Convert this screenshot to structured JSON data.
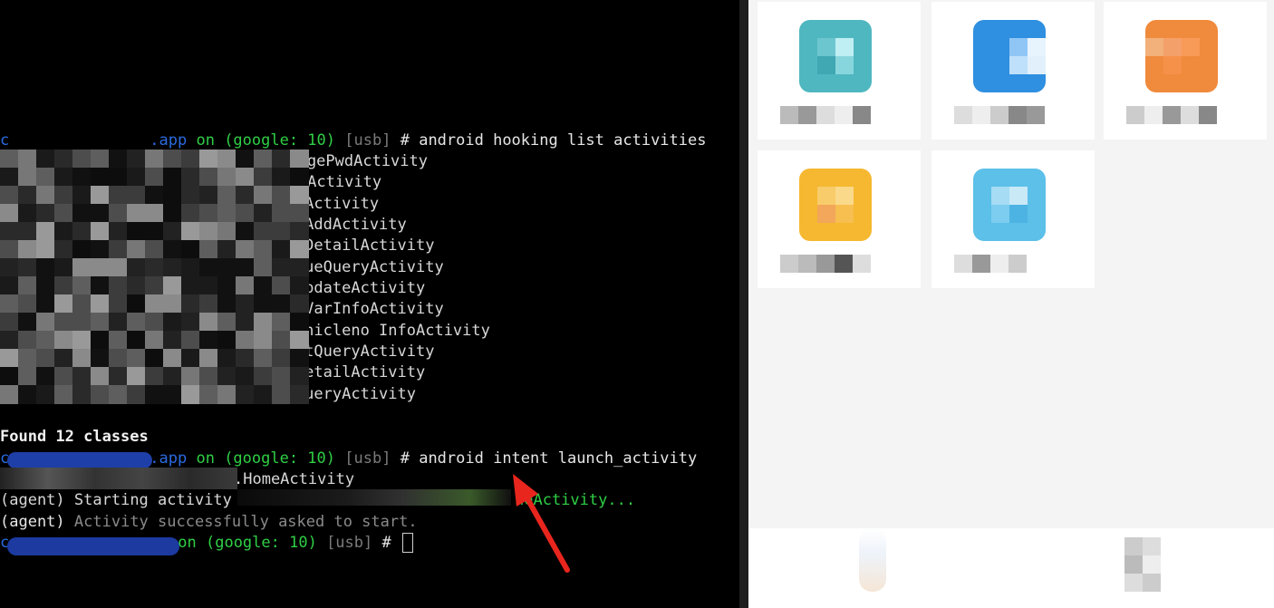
{
  "terminal": {
    "prompt": {
      "app_suffix": ".app",
      "on": "on",
      "device": "(google: 10)",
      "transport": "[usb]",
      "hash": "#"
    },
    "command_list": "android hooking list activities",
    "activities": [
      "ChangePwdActivity",
      ".HomeActivity",
      ".  inActivity",
      "y.  eAddActivity",
      "y.  eDetailActivity",
      "y.  eueQueryActivity",
      "   eUpdateActivity",
      "   chVarInfoActivity",
      "   Vehicleno InfoActivity",
      "   entQueryActivity",
      "   tDetailActivity",
      "   tQueryActivity"
    ],
    "found": "Found 12 classes",
    "command_launch": "android intent launch_activity",
    "launch_arg": ".HomeActivity",
    "agent_prefix": "(agent)",
    "agent_starting": "Starting activity",
    "agent_starting_target": "neActivity...",
    "agent_success_prefix": "(agent)",
    "agent_success": "Activity successfully asked to start."
  },
  "colors": {
    "prompt_blue": "#2a6be0",
    "prompt_green": "#2fcf45",
    "bracket_gray": "#7a7a7a",
    "arrow_red": "#e8261e"
  },
  "phone": {
    "tiles": [
      {
        "name": "teal-app",
        "accent": "#4fb7c0"
      },
      {
        "name": "blue-app",
        "accent": "#2f8fe0"
      },
      {
        "name": "orange-app",
        "accent": "#f08a3c"
      },
      {
        "name": "yellow-app",
        "accent": "#f5b830"
      },
      {
        "name": "lightblue-app",
        "accent": "#5cc0e8"
      }
    ]
  },
  "annotation": {
    "arrow_icon": "red-arrow-icon"
  }
}
